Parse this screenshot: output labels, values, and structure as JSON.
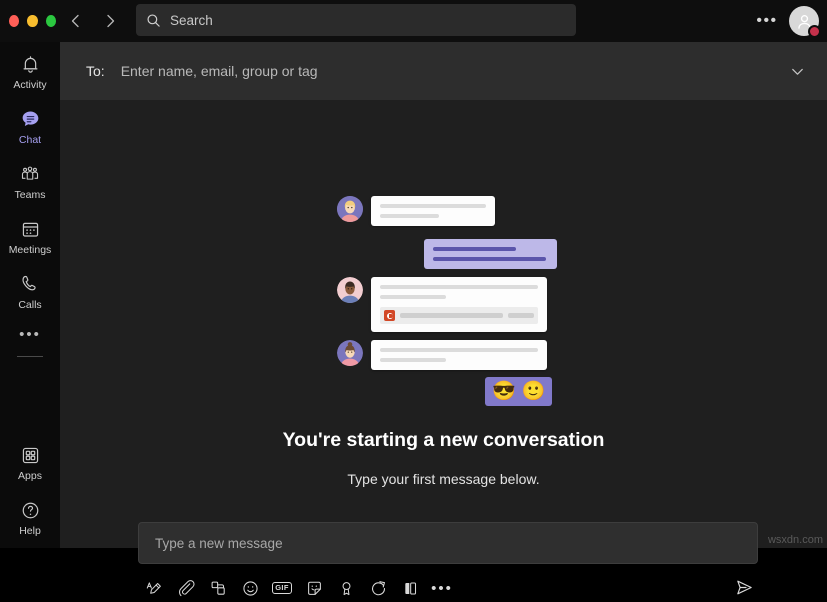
{
  "window": {
    "traffic_lights": [
      "close",
      "minimize",
      "maximize"
    ],
    "colors": {
      "close": "#ff5f57",
      "minimize": "#f8bd2e",
      "maximize": "#2bc840",
      "accent": "#6264a7",
      "accent_light": "#a6a0f0",
      "bubble_out": "#bdb8e8",
      "bubble_out_text": "#5b55ab",
      "presence_busy": "#c4314b",
      "powerpoint": "#d24726"
    }
  },
  "titlebar": {
    "back_icon": "chevron-left-icon",
    "forward_icon": "chevron-right-icon",
    "search": {
      "icon": "search-icon",
      "placeholder": "Search",
      "value": ""
    },
    "more_label": "•••",
    "avatar": {
      "icon": "person-icon",
      "presence": "busy"
    }
  },
  "sidebar": {
    "items": [
      {
        "label": "Activity",
        "icon": "bell-icon",
        "active": false
      },
      {
        "label": "Chat",
        "icon": "chat-bubble-icon",
        "active": true
      },
      {
        "label": "Teams",
        "icon": "people-icon",
        "active": false
      },
      {
        "label": "Meetings",
        "icon": "calendar-icon",
        "active": false
      },
      {
        "label": "Calls",
        "icon": "phone-icon",
        "active": false
      }
    ],
    "more_label": "•••",
    "bottom_items": [
      {
        "label": "Apps",
        "icon": "apps-grid-icon"
      },
      {
        "label": "Help",
        "icon": "question-circle-icon"
      }
    ]
  },
  "recipient_bar": {
    "label": "To:",
    "placeholder": "Enter name, email, group or tag",
    "value": "",
    "expand_icon": "chevron-down-icon"
  },
  "empty_state": {
    "headline": "You're starting a new conversation",
    "subline": "Type your first message below.",
    "illustration": {
      "messages": [
        {
          "from": "other",
          "avatar": "avatar-blonde",
          "lines": 2
        },
        {
          "from": "self",
          "lines": 2
        },
        {
          "from": "other",
          "avatar": "avatar-dark-hair",
          "lines": 2,
          "attachment": "powerpoint-file"
        },
        {
          "from": "other",
          "avatar": "avatar-bun",
          "lines": 2
        },
        {
          "from": "self",
          "emojis": [
            "😎",
            "🙂"
          ]
        }
      ]
    }
  },
  "composer": {
    "placeholder": "Type a new message",
    "value": "",
    "tools": [
      {
        "name": "format-icon",
        "label": "Format"
      },
      {
        "name": "attach-icon",
        "label": "Attach"
      },
      {
        "name": "loop-components-icon",
        "label": "Loop components"
      },
      {
        "name": "emoji-icon",
        "label": "Emoji"
      },
      {
        "name": "gif-icon",
        "label": "GIF"
      },
      {
        "name": "sticker-icon",
        "label": "Sticker"
      },
      {
        "name": "praise-icon",
        "label": "Praise"
      },
      {
        "name": "meet-now-icon",
        "label": "Meet now"
      },
      {
        "name": "approvals-icon",
        "label": "Approvals"
      },
      {
        "name": "more-options-icon",
        "label": "•••"
      }
    ],
    "send_icon": "send-icon"
  },
  "watermark": "wsxdn.com"
}
